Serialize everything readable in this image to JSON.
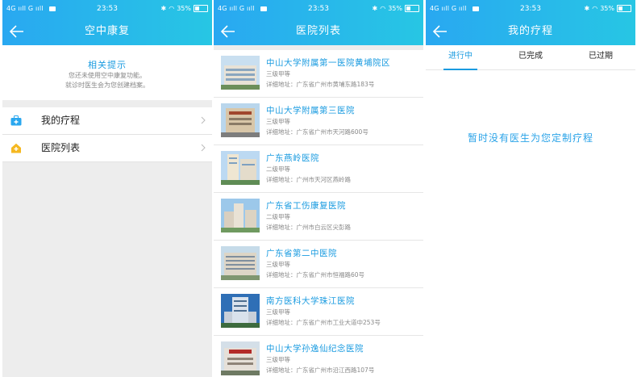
{
  "status": {
    "carrier": "4G ııll G ııll",
    "time": "23:53",
    "battery": "35%"
  },
  "screen1": {
    "title": "空中康复",
    "tips": {
      "title": "相关提示",
      "line1": "您还未使用空中康复功能。",
      "line2": "就诊时医生会为您创建档案。"
    },
    "menu": [
      {
        "label": "我的疗程",
        "icon": "medical-kit-icon"
      },
      {
        "label": "医院列表",
        "icon": "hospital-icon"
      }
    ]
  },
  "screen2": {
    "title": "医院列表",
    "hospitals": [
      {
        "name": "中山大学附属第一医院黄埔院区",
        "grade": "三级甲等",
        "address": "详细地址：广东省广州市黄埔东路183号"
      },
      {
        "name": "中山大学附属第三医院",
        "grade": "三级甲等",
        "address": "详细地址：广东省广州市天河路600号"
      },
      {
        "name": "广东燕岭医院",
        "grade": "二级甲等",
        "address": "详细地址：广州市天河区燕岭路"
      },
      {
        "name": "广东省工伤康复医院",
        "grade": "二级甲等",
        "address": "详细地址：广州市白云区尖彭路"
      },
      {
        "name": "广东省第二中医院",
        "grade": "三级甲等",
        "address": "详细地址：广东省广州市恒福路60号"
      },
      {
        "name": "南方医科大学珠江医院",
        "grade": "三级甲等",
        "address": "详细地址：广东省广州市工业大道中253号"
      },
      {
        "name": "中山大学孙逸仙纪念医院",
        "grade": "三级甲等",
        "address": "详细地址：广东省广州市沿江西路107号"
      }
    ]
  },
  "screen3": {
    "title": "我的疗程",
    "tabs": [
      "进行中",
      "已完成",
      "已过期"
    ],
    "empty_text": "暂时没有医生为您定制疗程"
  },
  "colors": {
    "accent": "#1a9be0",
    "header_start": "#29a8f1",
    "header_end": "#27c6e4"
  }
}
